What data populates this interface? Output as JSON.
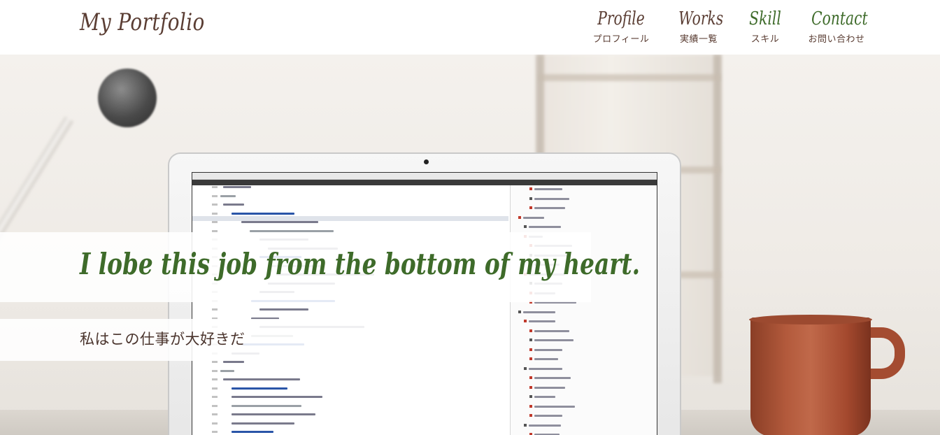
{
  "header": {
    "logo": "My Portfolio",
    "nav": [
      {
        "en": "Profile",
        "ja": "プロフィール"
      },
      {
        "en": "Works",
        "ja": "実績一覧"
      },
      {
        "en": "Skill",
        "ja": "スキル"
      },
      {
        "en": "Contact",
        "ja": "お問い合わせ"
      }
    ]
  },
  "hero": {
    "tagline": "I lobe this job from the bottom of my heart.",
    "subtitle": "私はこの仕事が大好きだ"
  },
  "colors": {
    "logo": "#5a3d33",
    "nav_profile": "#5a3d33",
    "nav_works": "#5a3d33",
    "nav_skill": "#3e6b2a",
    "nav_contact": "#3e6b2a",
    "tagline": "#3e6b2a",
    "subtitle": "#4a342d",
    "mug": "#b35a3c"
  },
  "icons": {
    "hero_background": "laptop-with-code-and-coffee-mug-photo"
  }
}
